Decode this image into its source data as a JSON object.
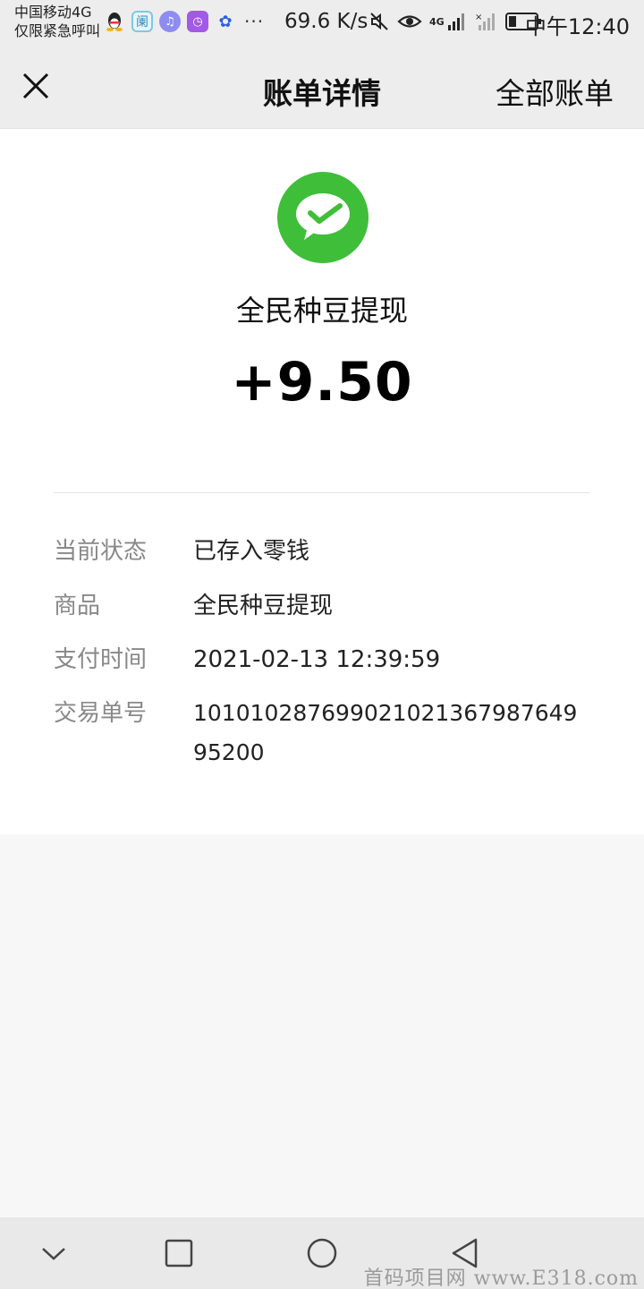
{
  "status_bar": {
    "carrier_line1": "中国移动4G",
    "carrier_line2": "仅限紧急呼叫",
    "more": "···",
    "network_speed": "69.6 K/s",
    "network_label": "4G",
    "clock": "中午12:40",
    "icons": [
      "qq-icon",
      "app-icon",
      "music-icon",
      "clock-app-icon",
      "baidu-icon",
      "mute-icon",
      "eye-icon",
      "signal-icon",
      "no-signal-icon",
      "battery-icon"
    ]
  },
  "nav": {
    "title": "账单详情",
    "right_link": "全部账单",
    "close_icon": "close-icon"
  },
  "bill": {
    "merchant_name": "全民种豆提现",
    "amount": "+9.50",
    "logo_icon": "wechat-pay-icon",
    "logo_color": "#3fbe3a",
    "details": [
      {
        "label": "当前状态",
        "value": "已存入零钱"
      },
      {
        "label": "商品",
        "value": "全民种豆提现"
      },
      {
        "label": "支付时间",
        "value": "2021-02-13 12:39:59"
      },
      {
        "label": "交易单号",
        "value": "10101028769902102136798764995200"
      }
    ]
  },
  "system_nav": {
    "buttons": [
      "chevron-down-icon",
      "recent-apps-icon",
      "home-icon",
      "back-icon"
    ]
  },
  "watermark": "首码项目网 www.E318.com"
}
